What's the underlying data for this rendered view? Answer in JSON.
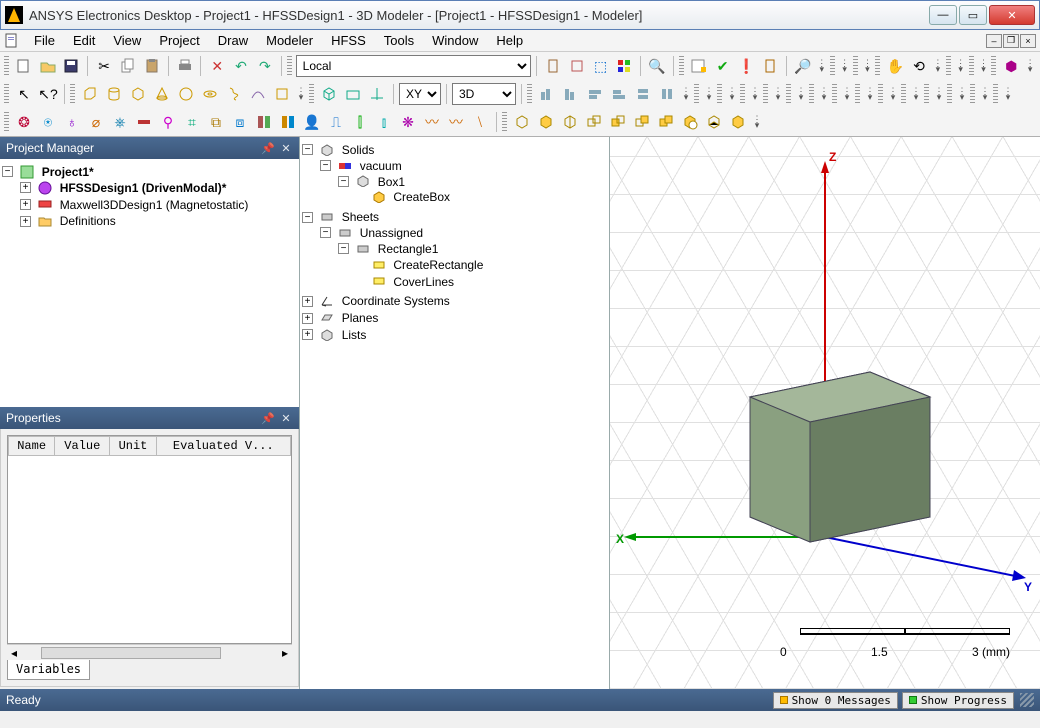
{
  "window": {
    "title": "ANSYS Electronics Desktop - Project1 - HFSSDesign1 - 3D Modeler - [Project1 - HFSSDesign1 - Modeler]"
  },
  "menu": {
    "items": [
      "File",
      "Edit",
      "View",
      "Project",
      "Draw",
      "Modeler",
      "HFSS",
      "Tools",
      "Window",
      "Help"
    ]
  },
  "dropdowns": {
    "coord": "Local",
    "plane": "XY",
    "mode": "3D"
  },
  "project_manager": {
    "title": "Project Manager",
    "root": "Project1*",
    "items": [
      {
        "label": "HFSSDesign1 (DrivenModal)*",
        "bold": true,
        "icon": "hfss"
      },
      {
        "label": "Maxwell3DDesign1 (Magnetostatic)",
        "bold": false,
        "icon": "maxwell"
      },
      {
        "label": "Definitions",
        "bold": false,
        "icon": "folder"
      }
    ]
  },
  "properties": {
    "title": "Properties",
    "headers": [
      "Name",
      "Value",
      "Unit",
      "Evaluated V..."
    ],
    "tab": "Variables"
  },
  "model_tree": {
    "solids": "Solids",
    "vacuum": "vacuum",
    "box1": "Box1",
    "createbox": "CreateBox",
    "sheets": "Sheets",
    "unassigned": "Unassigned",
    "rect1": "Rectangle1",
    "createrect": "CreateRectangle",
    "coverlines": "CoverLines",
    "coordsys": "Coordinate Systems",
    "planes": "Planes",
    "lists": "Lists"
  },
  "axes": {
    "x": "X",
    "y": "Y",
    "z": "Z"
  },
  "scale": {
    "v0": "0",
    "v1": "1.5",
    "v2": "3 (mm)"
  },
  "status": {
    "ready": "Ready",
    "messages": "Show 0 Messages",
    "progress": "Show Progress"
  }
}
